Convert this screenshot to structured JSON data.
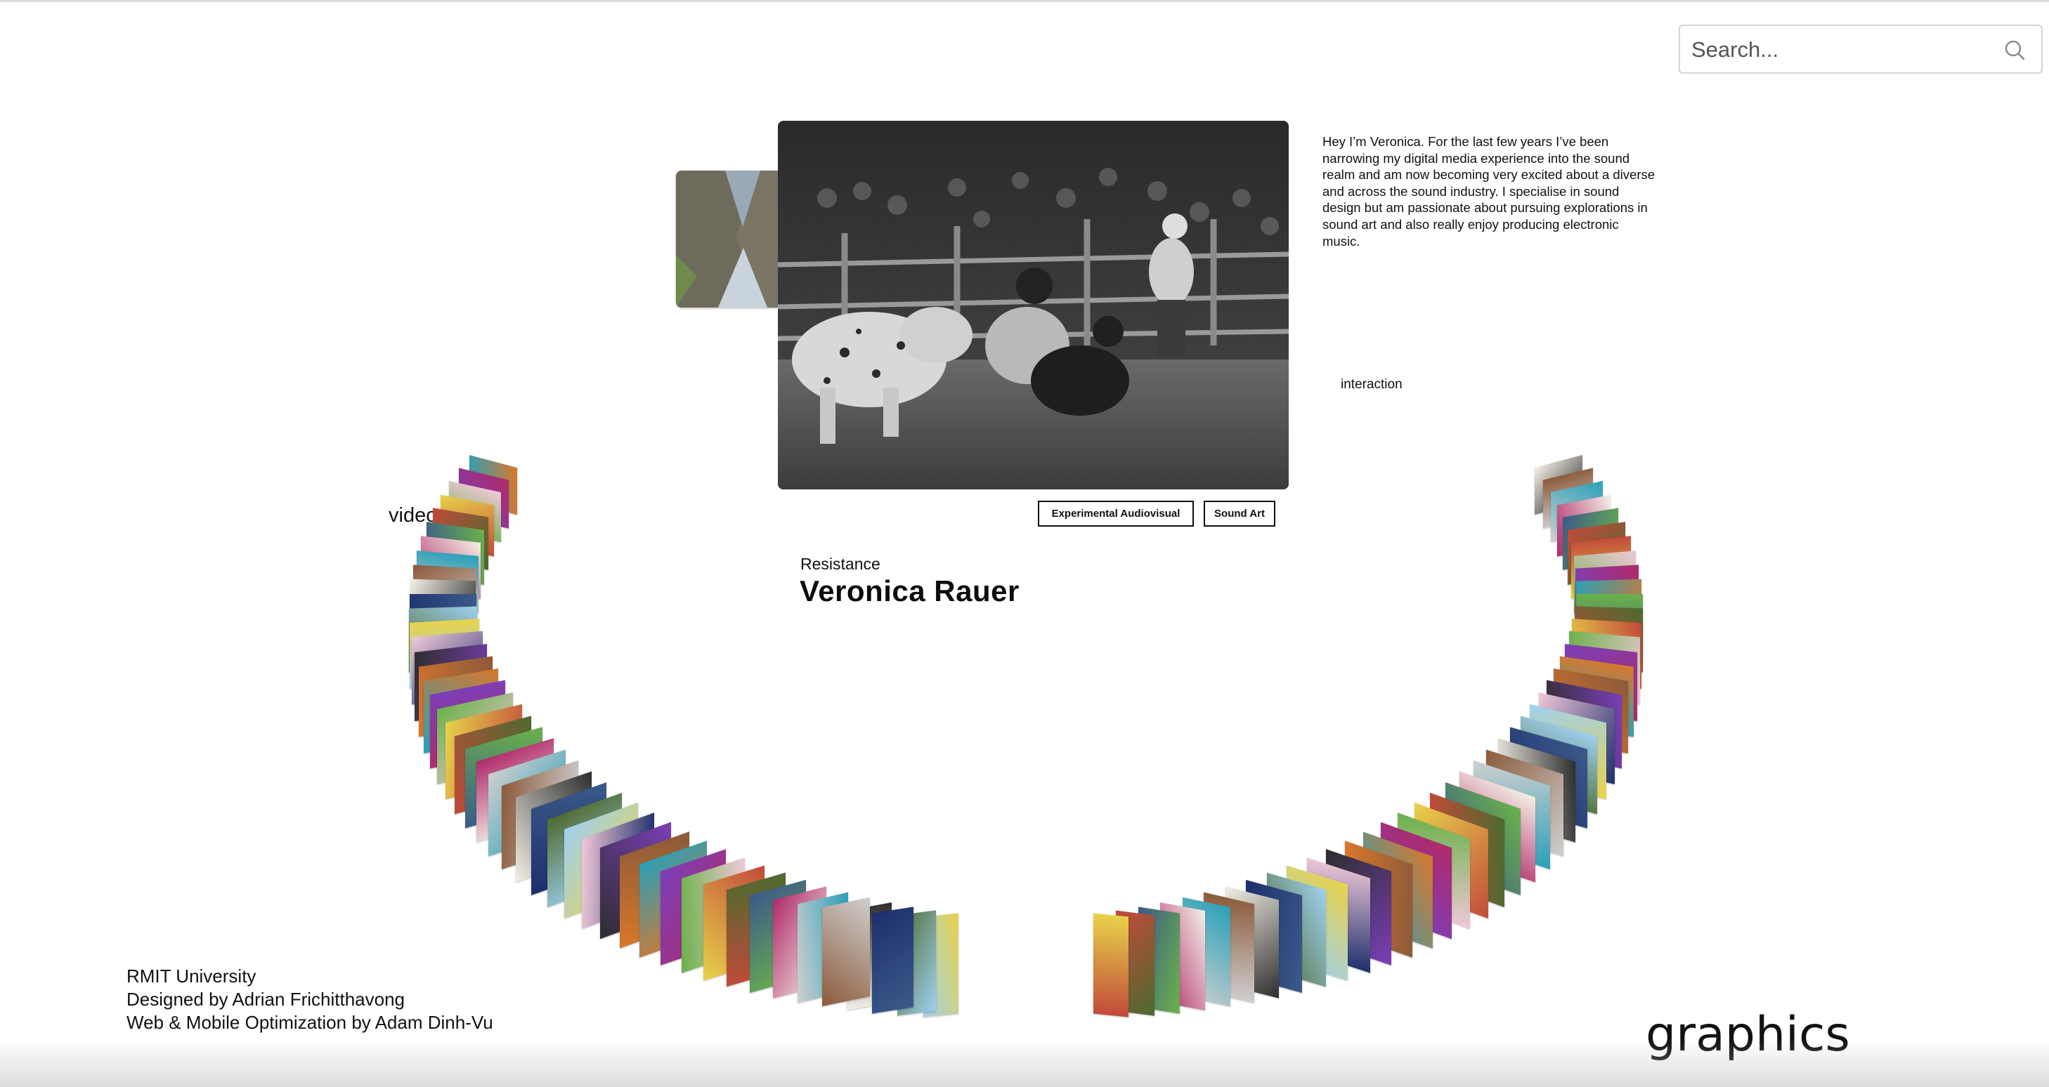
{
  "search": {
    "placeholder": "Search..."
  },
  "feature": {
    "image_alt": "Rodeo bull riding arena, black and white",
    "tags": [
      "Experimental Audiovisual",
      "Sound Art"
    ],
    "project_title": "Resistance",
    "name": "Veronica Rauer",
    "bio": "Hey I’m Veronica. For the last few years I’ve been narrowing my digital media experience into the sound realm and am now becoming very excited about a diverse and across the sound industry. I specialise in sound design but am passionate about pursuing explorations in sound art and also really enjoy producing electronic music."
  },
  "ring_labels": {
    "video": "video",
    "interaction": "interaction",
    "graphics": "graphics"
  },
  "footer": {
    "line1": "RMIT University",
    "line2": "Designed by Adrian Frichitthavong",
    "line3": "Web & Mobile Optimization by Adam Dinh-Vu"
  },
  "thumbnails": {
    "palette": [
      "#3b5a8a",
      "#c14a3a",
      "#e8d34a",
      "#6bb24a",
      "#7b3fb8",
      "#2aa0b8",
      "#d9772b",
      "#2d2d2d",
      "#f0c8d8",
      "#9fd0f0",
      "#4d6a2f",
      "#1d2f6b",
      "#f4f0e6",
      "#8c5a3a",
      "#cfcfcf",
      "#b02a6a"
    ]
  }
}
